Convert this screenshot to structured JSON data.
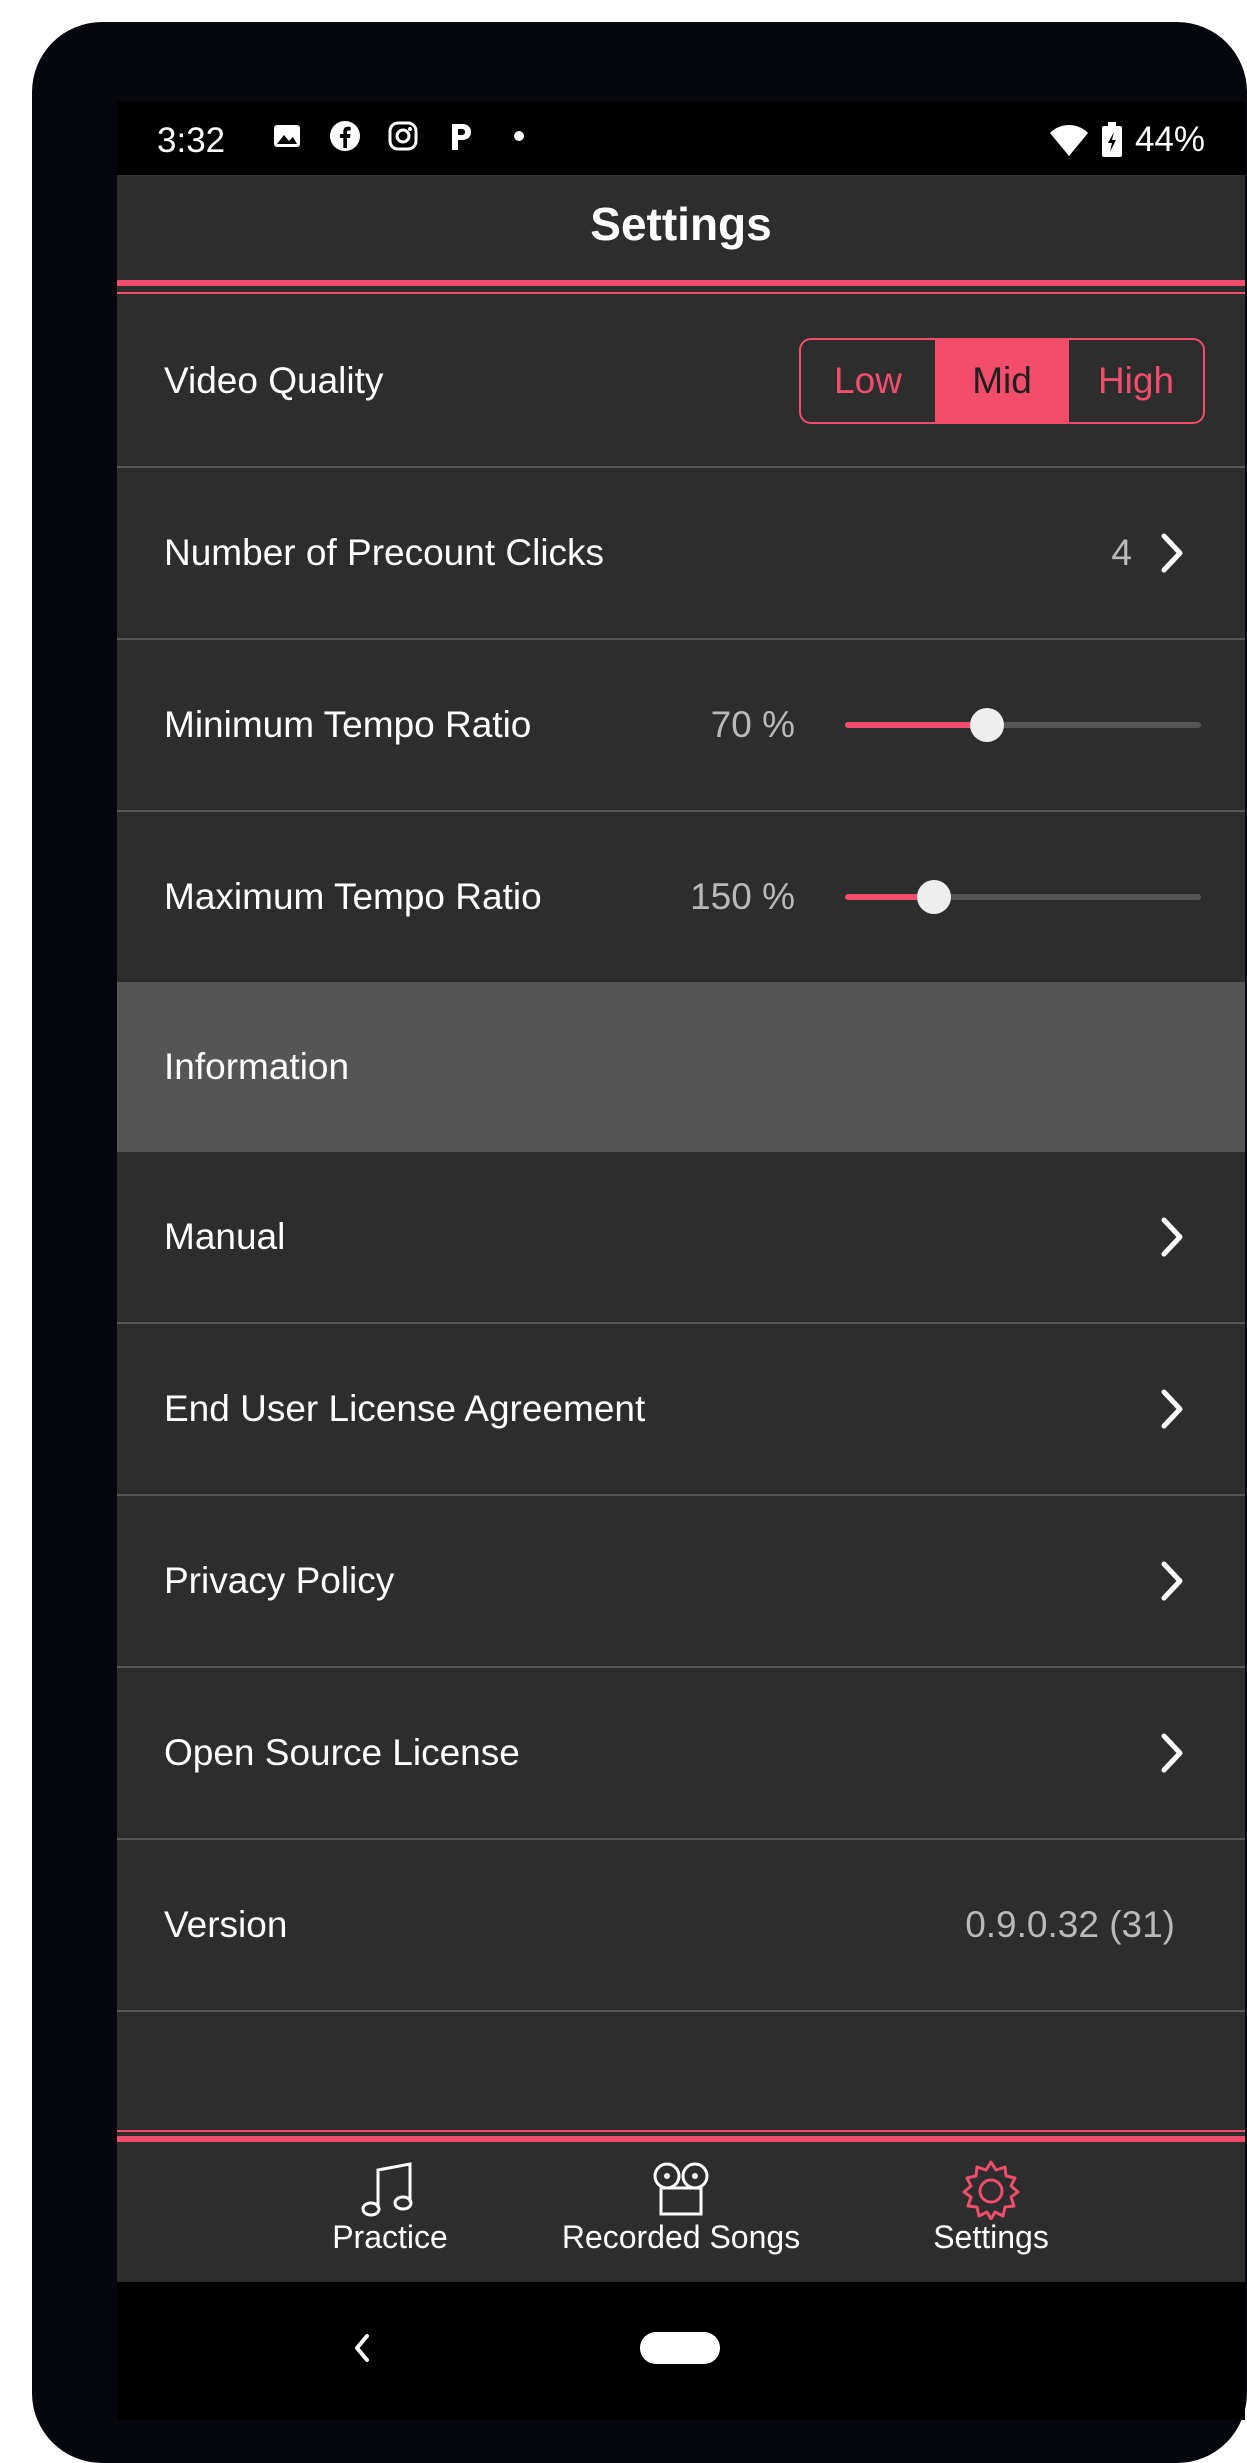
{
  "status": {
    "time": "3:32",
    "battery": "44%",
    "icons": [
      "image-icon",
      "facebook-icon",
      "instagram-icon",
      "p-icon",
      "dot-icon"
    ]
  },
  "header": {
    "title": "Settings"
  },
  "settings": {
    "video_quality": {
      "label": "Video Quality",
      "options": [
        "Low",
        "Mid",
        "High"
      ],
      "selected": "Mid"
    },
    "precount": {
      "label": "Number of Precount Clicks",
      "value": "4"
    },
    "min_tempo": {
      "label": "Minimum Tempo Ratio",
      "value": "70 %",
      "level": 0.4
    },
    "max_tempo": {
      "label": "Maximum Tempo Ratio",
      "value": "150 %",
      "level": 0.25
    }
  },
  "information": {
    "header": "Information",
    "items": [
      "Manual",
      "End User License Agreement",
      "Privacy Policy",
      "Open Source License"
    ],
    "version_label": "Version",
    "version_value": "0.9.0.32 (31)"
  },
  "nav": {
    "items": [
      "Practice",
      "Recorded Songs",
      "Settings"
    ],
    "active": "Settings"
  },
  "colors": {
    "accent": "#f24d6b",
    "background": "#2d2d2d",
    "section": "#555555"
  }
}
